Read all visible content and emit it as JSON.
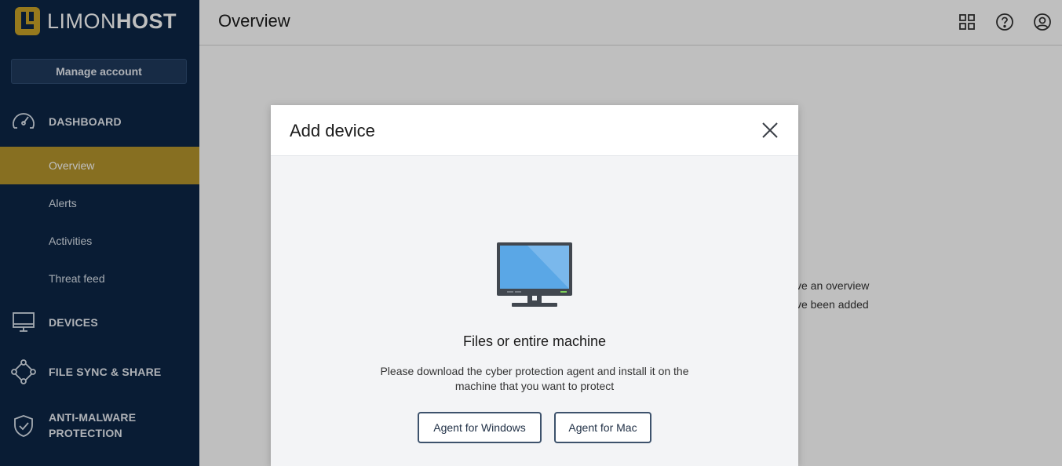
{
  "brand": {
    "name_light": "LIMON",
    "name_bold": "HOST"
  },
  "sidebar": {
    "manage_label": "Manage account",
    "dashboard_label": "DASHBOARD",
    "items": [
      {
        "label": "Overview"
      },
      {
        "label": "Alerts"
      },
      {
        "label": "Activities"
      },
      {
        "label": "Threat feed"
      }
    ],
    "devices_label": "DEVICES",
    "filesync_label": "FILE SYNC & SHARE",
    "antimalware_label": "ANTI-MALWARE PROTECTION",
    "antimalware_line1": "ANTI-MALWARE",
    "antimalware_line2": "PROTECTION"
  },
  "header": {
    "title": "Overview",
    "icons": [
      "grid-icon",
      "help-icon",
      "user-icon"
    ]
  },
  "background": {
    "line1": "ve an overview",
    "line2": "ve been added"
  },
  "modal": {
    "title": "Add device",
    "option_title": "Files or entire machine",
    "option_desc": "Please download the cyber protection agent and install it on the machine that you want to protect",
    "btn_windows": "Agent for Windows",
    "btn_mac": "Agent for Mac"
  },
  "colors": {
    "sidebar_bg": "#0d2646",
    "accent": "#b4952c",
    "modal_bg": "#f3f4f6",
    "button_border": "#3d526c"
  }
}
